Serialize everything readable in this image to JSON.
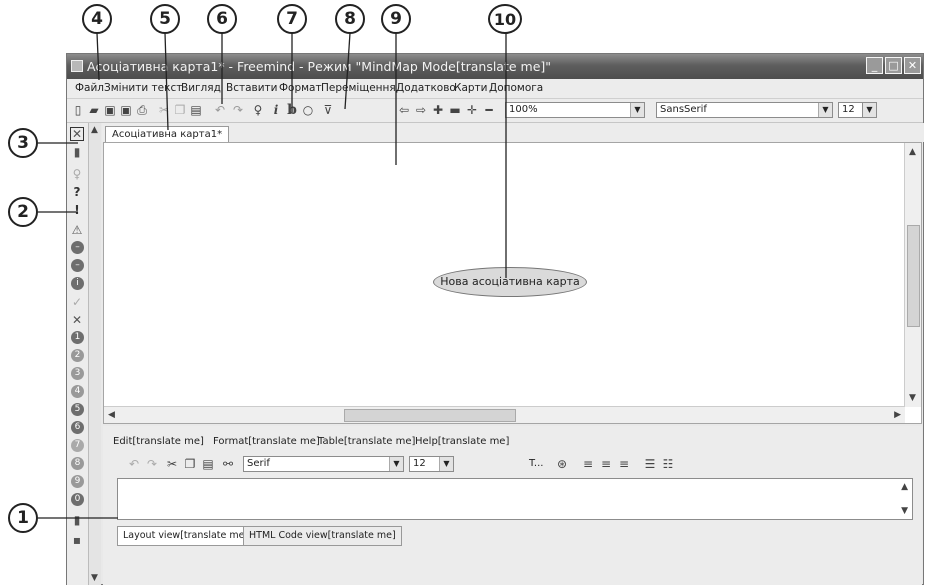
{
  "window": {
    "title": "Асоціативна карта1* - Freemind - Режим \"MindMap Mode[translate me]\"",
    "buttons": {
      "minimize": "_",
      "maximize": "□",
      "close": "✕"
    }
  },
  "menu": [
    "Файл",
    "Змінити текст",
    "Вигляд",
    "Вставити",
    "Формат",
    "Переміщення",
    "Додатково",
    "Карти",
    "Допомога"
  ],
  "toolbar": {
    "zoom": "100%",
    "font_family": "SansSerif",
    "font_size": "12",
    "italic_label": "i",
    "bold_label": "b"
  },
  "tabs": {
    "map_tab": "Асоціативна карта1*"
  },
  "map": {
    "root_node": "Нова асоціативна карта"
  },
  "editor": {
    "menu": [
      "Edit[translate me]",
      "Format[translate me]",
      "Table[translate me]",
      "Help[translate me]"
    ],
    "font_family": "Serif",
    "font_size": "12",
    "text_label": "T...",
    "view_tabs": [
      "Layout view[translate me]",
      "HTML Code view[translate me]"
    ]
  },
  "callouts": [
    "1",
    "2",
    "3",
    "4",
    "5",
    "6",
    "7",
    "8",
    "9",
    "10"
  ]
}
